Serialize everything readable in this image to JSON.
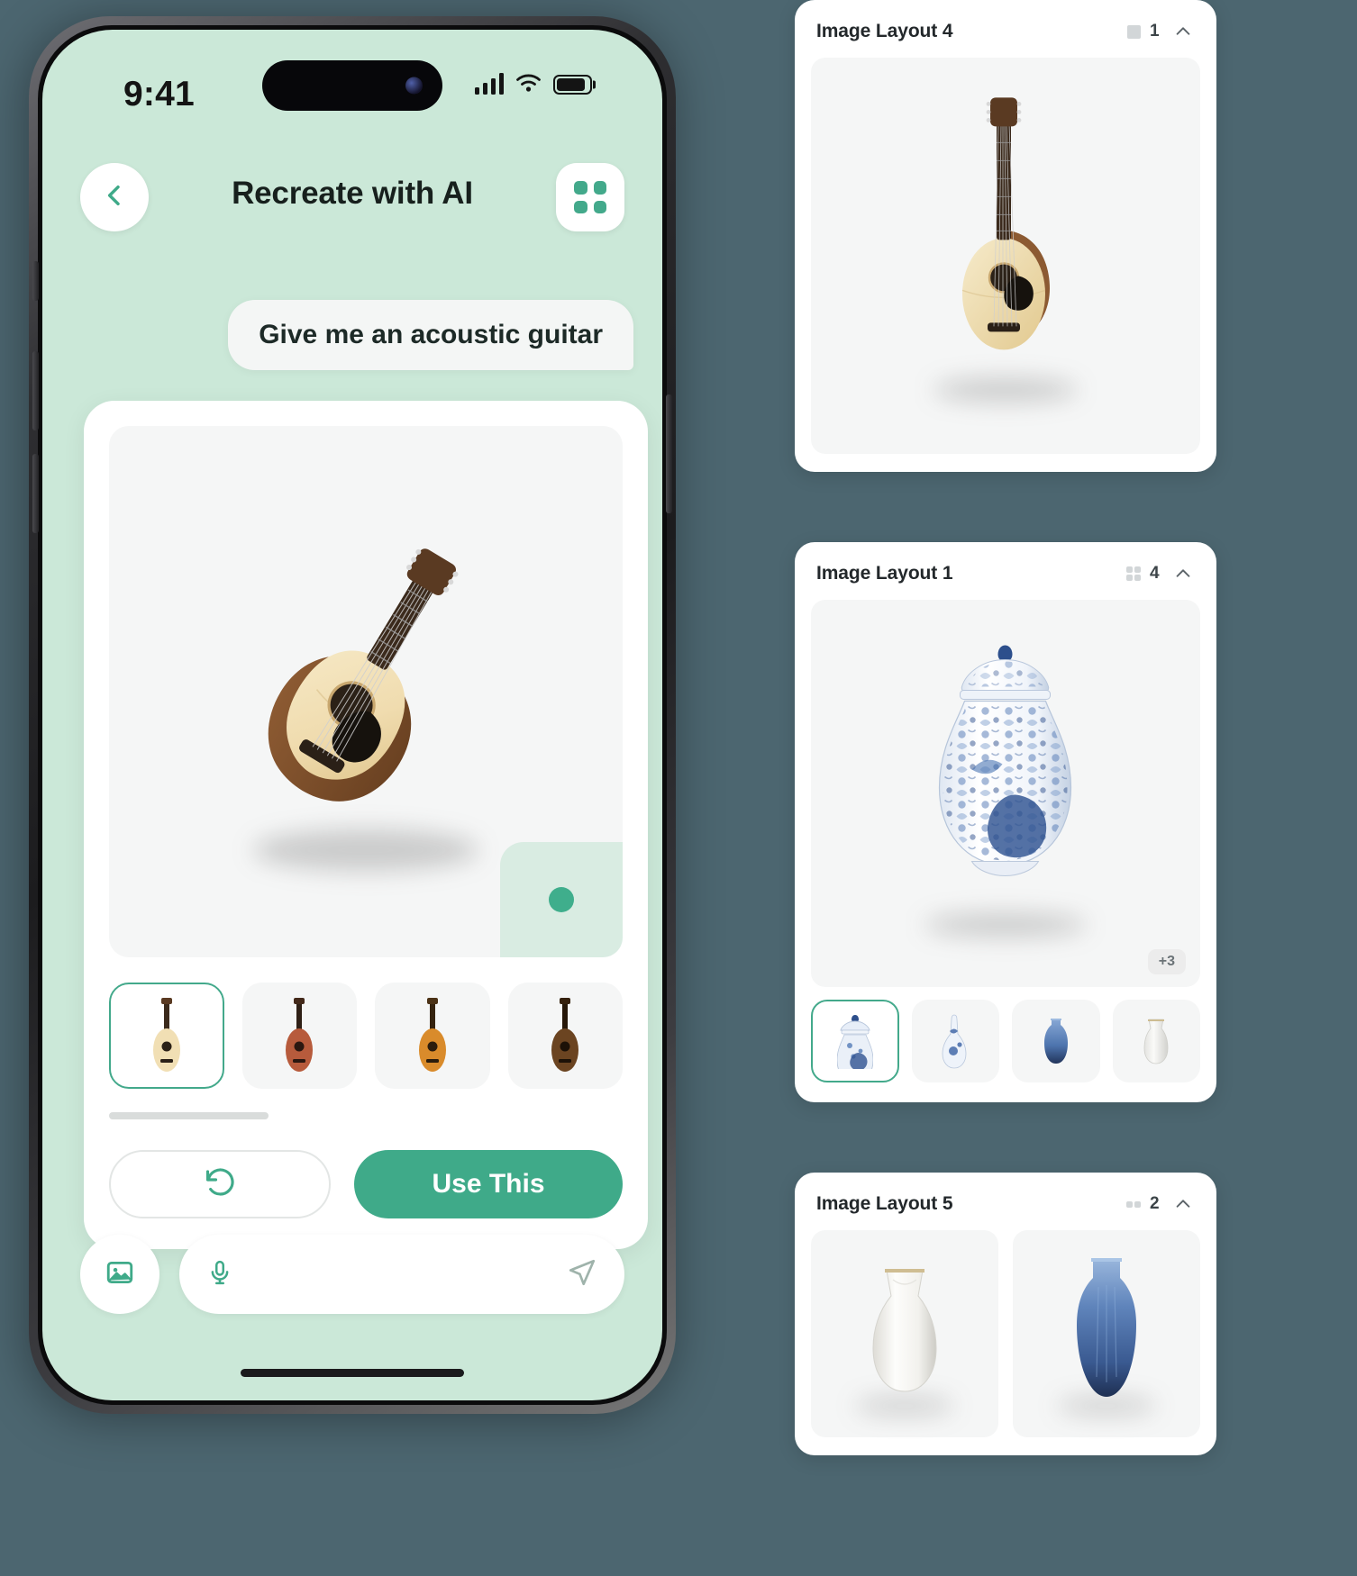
{
  "phone": {
    "status": {
      "time": "9:41",
      "signal_icon": "cellular-signal-icon",
      "wifi_icon": "wifi-icon",
      "battery_icon": "battery-icon"
    },
    "nav": {
      "back_icon": "chevron-left-icon",
      "title": "Recreate with AI",
      "grid_icon": "grid-view-icon"
    },
    "chat": {
      "user_message": "Give me an acoustic guitar"
    },
    "result": {
      "hero_alt": "acoustic-guitar",
      "selected_index": 0,
      "thumbnails": [
        {
          "alt": "acoustic guitar natural blonde",
          "selected": true
        },
        {
          "alt": "acoustic guitar mahogany red"
        },
        {
          "alt": "acoustic guitar amber dreadnought"
        },
        {
          "alt": "acoustic guitar dark walnut"
        }
      ],
      "undo_icon": "undo-arrow-icon",
      "use_label": "Use This"
    },
    "composer": {
      "image_icon": "image-picker-icon",
      "mic_icon": "microphone-icon",
      "send_icon": "send-icon",
      "placeholder": ""
    }
  },
  "panels": [
    {
      "title": "Image Layout 4",
      "count": "1",
      "count_icon": "layout-single-icon",
      "chevron_icon": "chevron-up-icon",
      "layout": "single",
      "stage_alt": "acoustic guitar natural blonde",
      "plus_badge": "",
      "thumbnails": []
    },
    {
      "title": "Image Layout 1",
      "count": "4",
      "count_icon": "layout-grid-icon",
      "chevron_icon": "chevron-up-icon",
      "layout": "single-with-thumbs",
      "stage_alt": "blue and white porcelain ginger jar",
      "plus_badge": "+3",
      "thumbnails": [
        {
          "alt": "blue white ginger jar",
          "selected": true
        },
        {
          "alt": "blue white gourd vase"
        },
        {
          "alt": "blue glass vase"
        },
        {
          "alt": "white ceramic vase"
        }
      ]
    },
    {
      "title": "Image Layout 5",
      "count": "2",
      "count_icon": "layout-duo-icon",
      "chevron_icon": "chevron-up-icon",
      "layout": "duo",
      "duo": [
        {
          "alt": "white ceramic vase with gold rim"
        },
        {
          "alt": "blue glass ribbed vase"
        }
      ]
    }
  ],
  "colors": {
    "accent": "#3faa89",
    "phone_bg": "#cbe8d8",
    "page_bg": "#4c6670",
    "card_bg": "#ffffff",
    "stage_bg": "#f5f6f6"
  }
}
